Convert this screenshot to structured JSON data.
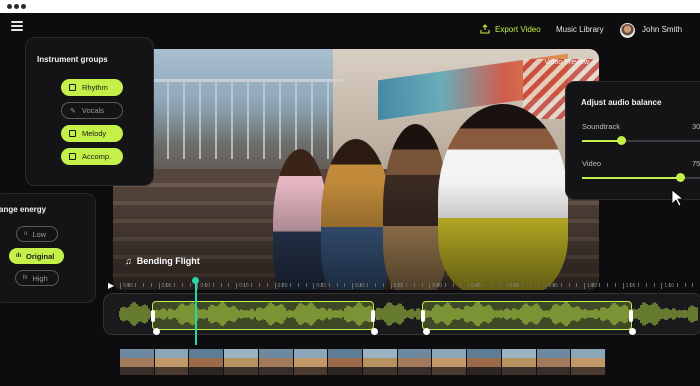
{
  "header": {
    "export_label": "Export Video",
    "music_library_label": "Music Library",
    "user_name": "John Smith"
  },
  "video": {
    "preview_label": "Video Preview",
    "track_title": "Bending Flight"
  },
  "instrument_groups": {
    "title": "Instrument groups",
    "items": [
      {
        "label": "Rhythm",
        "active": true,
        "icon": "drum-icon"
      },
      {
        "label": "Vocals",
        "active": false,
        "icon": "microphone-icon"
      },
      {
        "label": "Melody",
        "active": true,
        "icon": "keyboard-icon"
      },
      {
        "label": "Accomp.",
        "active": true,
        "icon": "guitar-icon"
      }
    ]
  },
  "energy": {
    "title": "ange energy",
    "items": [
      {
        "label": "Low",
        "active": false
      },
      {
        "label": "Original",
        "active": true
      },
      {
        "label": "High",
        "active": false
      }
    ]
  },
  "audio_balance": {
    "title": "Adjust audio balance",
    "sliders": [
      {
        "label": "Soundtrack",
        "value_text": "30",
        "level": 0.3
      },
      {
        "label": "Video",
        "value_text": "75",
        "level": 0.75
      }
    ]
  },
  "timeline": {
    "ticks": [
      "0:00",
      "0:05",
      "0:10",
      "0:15",
      "0:20",
      "0:25",
      "0:30",
      "0:35",
      "0:40",
      "0:45",
      "0:50",
      "0:55",
      "1:00",
      "1:05",
      "1:10"
    ],
    "playhead_time_fraction": 0.13,
    "segments": [
      {
        "start_fraction": 0.08,
        "end_fraction": 0.45
      },
      {
        "start_fraction": 0.53,
        "end_fraction": 0.88
      }
    ],
    "play_icon": "play-icon"
  },
  "colors": {
    "accent": "#c4f04a",
    "playhead": "#2ed3a8",
    "background": "#0d0d0f"
  }
}
